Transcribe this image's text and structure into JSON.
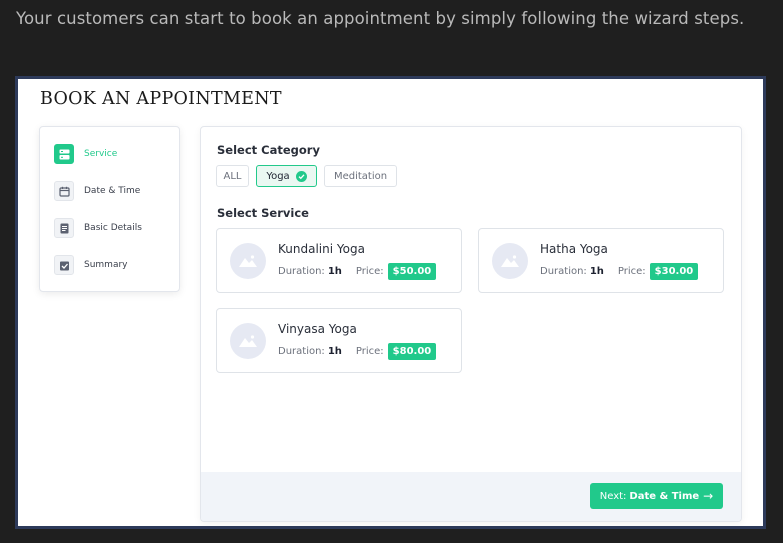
{
  "intro_text": "Your customers can start to book an appointment by simply following the wizard steps.",
  "page_title": "BOOK AN APPOINTMENT",
  "steps": [
    {
      "label": "Service",
      "icon": "service-icon",
      "active": true
    },
    {
      "label": "Date & Time",
      "icon": "calendar-icon",
      "active": false
    },
    {
      "label": "Basic Details",
      "icon": "details-icon",
      "active": false
    },
    {
      "label": "Summary",
      "icon": "summary-icon",
      "active": false
    }
  ],
  "category": {
    "label": "Select Category",
    "options": [
      "ALL",
      "Yoga",
      "Meditation"
    ],
    "selected": "Yoga"
  },
  "service": {
    "label": "Select Service",
    "duration_label": "Duration:",
    "price_label": "Price:",
    "items": [
      {
        "name": "Kundalini Yoga",
        "duration": "1h",
        "price": "$50.00"
      },
      {
        "name": "Hatha Yoga",
        "duration": "1h",
        "price": "$30.00"
      },
      {
        "name": "Vinyasa Yoga",
        "duration": "1h",
        "price": "$80.00"
      }
    ]
  },
  "next_button": {
    "prefix": "Next:",
    "label": "Date & Time",
    "arrow": "→"
  },
  "colors": {
    "accent": "#21c98b",
    "background": "#1f1f1f",
    "frame": "#2d3a5a"
  }
}
